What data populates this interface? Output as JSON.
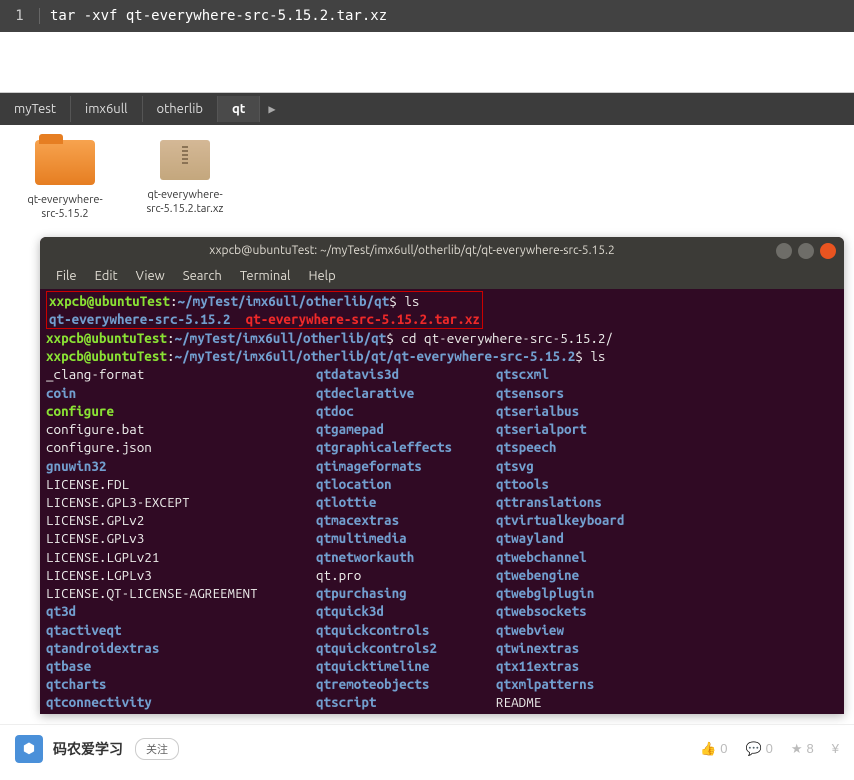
{
  "codeblock": {
    "line_number": "1",
    "command": "tar -xvf qt-everywhere-src-5.15.2.tar.xz"
  },
  "breadcrumb": {
    "items": [
      "myTest",
      "imx6ull",
      "otherlib",
      "qt"
    ],
    "active_index": 3
  },
  "files": [
    {
      "name": "qt-everywhere-src-5.15.2",
      "type": "folder"
    },
    {
      "name": "qt-everywhere-src-5.15.2.tar.xz",
      "type": "archive"
    }
  ],
  "terminal": {
    "title": "xxpcb@ubuntuTest: ~/myTest/imx6ull/otherlib/qt/qt-everywhere-src-5.15.2",
    "menus": [
      "File",
      "Edit",
      "View",
      "Search",
      "Terminal",
      "Help"
    ],
    "prompt_user": "xxpcb@ubuntuTest",
    "path1": "~/myTest/imx6ull/otherlib/qt",
    "path2": "~/myTest/imx6ull/otherlib/qt/qt-everywhere-src-5.15.2",
    "cmd_ls": "ls",
    "cmd_cd": "cd qt-everywhere-src-5.15.2/",
    "ls1_dir": "qt-everywhere-src-5.15.2",
    "ls1_archive": "qt-everywhere-src-5.15.2.tar.xz",
    "ls_output": [
      [
        "_clang-format",
        "white",
        "qtdatavis3d",
        "dir",
        "qtscxml",
        "dir"
      ],
      [
        "coin",
        "dir",
        "qtdeclarative",
        "dir",
        "qtsensors",
        "dir"
      ],
      [
        "configure",
        "exec",
        "qtdoc",
        "dir",
        "qtserialbus",
        "dir"
      ],
      [
        "configure.bat",
        "white",
        "qtgamepad",
        "dir",
        "qtserialport",
        "dir"
      ],
      [
        "configure.json",
        "white",
        "qtgraphicaleffects",
        "dir",
        "qtspeech",
        "dir"
      ],
      [
        "gnuwin32",
        "dir",
        "qtimageformats",
        "dir",
        "qtsvg",
        "dir"
      ],
      [
        "LICENSE.FDL",
        "white",
        "qtlocation",
        "dir",
        "qttools",
        "dir"
      ],
      [
        "LICENSE.GPL3-EXCEPT",
        "white",
        "qtlottie",
        "dir",
        "qttranslations",
        "dir"
      ],
      [
        "LICENSE.GPLv2",
        "white",
        "qtmacextras",
        "dir",
        "qtvirtualkeyboard",
        "dir"
      ],
      [
        "LICENSE.GPLv3",
        "white",
        "qtmultimedia",
        "dir",
        "qtwayland",
        "dir"
      ],
      [
        "LICENSE.LGPLv21",
        "white",
        "qtnetworkauth",
        "dir",
        "qtwebchannel",
        "dir"
      ],
      [
        "LICENSE.LGPLv3",
        "white",
        "qt.pro",
        "white",
        "qtwebengine",
        "dir"
      ],
      [
        "LICENSE.QT-LICENSE-AGREEMENT",
        "white",
        "qtpurchasing",
        "dir",
        "qtwebglplugin",
        "dir"
      ],
      [
        "qt3d",
        "dir",
        "qtquick3d",
        "dir",
        "qtwebsockets",
        "dir"
      ],
      [
        "qtactiveqt",
        "dir",
        "qtquickcontrols",
        "dir",
        "qtwebview",
        "dir"
      ],
      [
        "qtandroidextras",
        "dir",
        "qtquickcontrols2",
        "dir",
        "qtwinextras",
        "dir"
      ],
      [
        "qtbase",
        "dir",
        "qtquicktimeline",
        "dir",
        "qtx11extras",
        "dir"
      ],
      [
        "qtcharts",
        "dir",
        "qtremoteobjects",
        "dir",
        "qtxmlpatterns",
        "dir"
      ],
      [
        "qtconnectivity",
        "dir",
        "qtscript",
        "dir",
        "README",
        "white"
      ]
    ]
  },
  "footer": {
    "author": "码农爱学习",
    "follow": "关注",
    "stats": {
      "like": "0",
      "comment": "0",
      "star": "8"
    }
  }
}
